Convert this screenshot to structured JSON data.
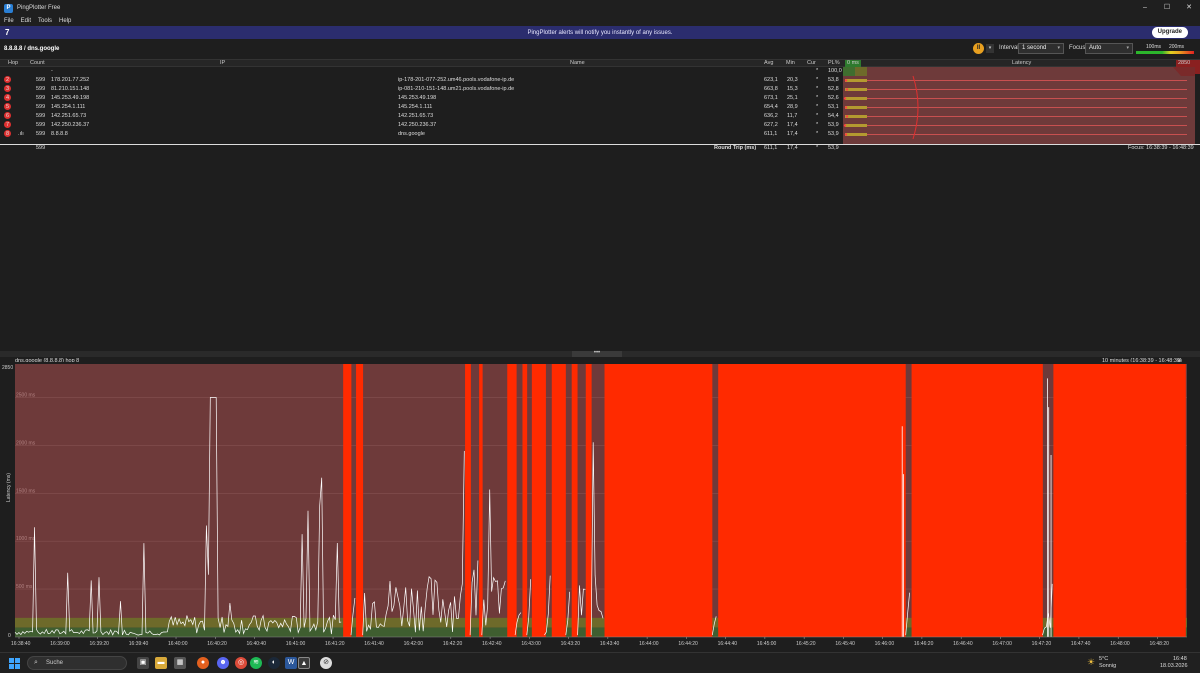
{
  "window": {
    "title": "PingPlotter Free",
    "app_icon": "pingplotter-logo-icon"
  },
  "menu": [
    "File",
    "Edit",
    "Tools",
    "Help"
  ],
  "banner": {
    "message": "PingPlotter alerts will notify you instantly of any issues.",
    "upgrade_label": "Upgrade",
    "logo_glyph": "7"
  },
  "toolbar": {
    "target": "8.8.8.8 / dns.google",
    "interval_label": "Interval",
    "interval_value": "1 second",
    "focus_label": "Focus",
    "focus_value": "Auto",
    "scale_low": "100ms",
    "scale_high": "200ms"
  },
  "columns": {
    "hop": "Hop",
    "count": "Count",
    "ip": "IP",
    "name": "Name",
    "avg": "Avg",
    "min": "Min",
    "cur": "Cur",
    "pl": "PL%",
    "lat_min": "0 ms",
    "latency": "Latency",
    "lat_max": "2850 ms"
  },
  "hops": [
    {
      "hop": "",
      "count": "",
      "ip": "-",
      "name": "",
      "avg": "",
      "min": "",
      "cur": "*",
      "pl": "100,0",
      "badge": false
    },
    {
      "hop": "2",
      "count": "599",
      "ip": "178.201.77.252",
      "name": "ip-178-201-077-252.um46.pools.vodafone-ip.de",
      "avg": "623,1",
      "min": "20,3",
      "cur": "*",
      "pl": "53,8",
      "badge": true
    },
    {
      "hop": "3",
      "count": "599",
      "ip": "81.210.151.148",
      "name": "ip-081-210-151-148.um21.pools.vodafone-ip.de",
      "avg": "663,8",
      "min": "15,3",
      "cur": "*",
      "pl": "52,8",
      "badge": true
    },
    {
      "hop": "4",
      "count": "599",
      "ip": "145.253.49.198",
      "name": "145.253.49.198",
      "avg": "673,1",
      "min": "25,1",
      "cur": "*",
      "pl": "52,6",
      "badge": true
    },
    {
      "hop": "5",
      "count": "599",
      "ip": "145.254.1.111",
      "name": "145.254.1.111",
      "avg": "654,4",
      "min": "28,9",
      "cur": "*",
      "pl": "53,1",
      "badge": true
    },
    {
      "hop": "6",
      "count": "599",
      "ip": "142.251.65.73",
      "name": "142.251.65.73",
      "avg": "636,2",
      "min": "11,7",
      "cur": "*",
      "pl": "54,4",
      "badge": true
    },
    {
      "hop": "7",
      "count": "599",
      "ip": "142.250.236.37",
      "name": "142.250.236.37",
      "avg": "627,2",
      "min": "17,4",
      "cur": "*",
      "pl": "53,9",
      "badge": true
    },
    {
      "hop": "8",
      "count": "599",
      "ip": "8.8.8.8",
      "name": "dns.google",
      "avg": "611,1",
      "min": "17,4",
      "cur": "*",
      "pl": "53,9",
      "badge": true
    }
  ],
  "roundtrip": {
    "count": "599",
    "label": "Round Trip (ms)",
    "avg": "611,1",
    "min": "17,4",
    "cur": "*",
    "pl": "53,9",
    "focus": "Focus: 16:38:39 - 16:48:39"
  },
  "graph": {
    "title": "dns.google (8.8.8.8) hop 8",
    "range": "10 minutes (16:38:39 - 16:48:39)",
    "ylabel": "Latency (ms)",
    "ymax_label": "2850",
    "y_ticks": [
      "2500 ms",
      "2000 ms",
      "1500 ms",
      "1000 ms",
      "500 ms"
    ],
    "y_zero": "0",
    "x_ticks": [
      "16:38:40",
      "16:39:00",
      "16:39:20",
      "16:39:40",
      "16:40:00",
      "16:40:20",
      "16:40:40",
      "16:41:00",
      "16:41:20",
      "16:41:40",
      "16:42:00",
      "16:42:20",
      "16:42:40",
      "16:43:00",
      "16:43:20",
      "16:43:40",
      "16:44:00",
      "16:44:20",
      "16:44:40",
      "16:45:00",
      "16:45:20",
      "16:45:40",
      "16:46:00",
      "16:46:20",
      "16:46:40",
      "16:47:00",
      "16:47:20",
      "16:47:40",
      "16:48:00",
      "16:48:20"
    ]
  },
  "taskbar": {
    "search_label": "Suche",
    "weather_temp": "5°C",
    "weather_text": "Sonnig",
    "time": "16:48",
    "date": "18.03.2026",
    "icons": [
      "task-view-icon",
      "file-explorer-icon",
      "store-icon",
      "firefox-icon",
      "discord-icon",
      "chrome-icon",
      "spotify-icon",
      "steam-icon",
      "word-icon",
      "pingplotter-icon",
      "app-icon"
    ]
  },
  "colors": {
    "loss": "#ff2a00",
    "bg_red": "#6e3a3a",
    "band_yellow": "#6e6a2a",
    "band_green": "#3a5a34",
    "line": "#ffffff"
  }
}
